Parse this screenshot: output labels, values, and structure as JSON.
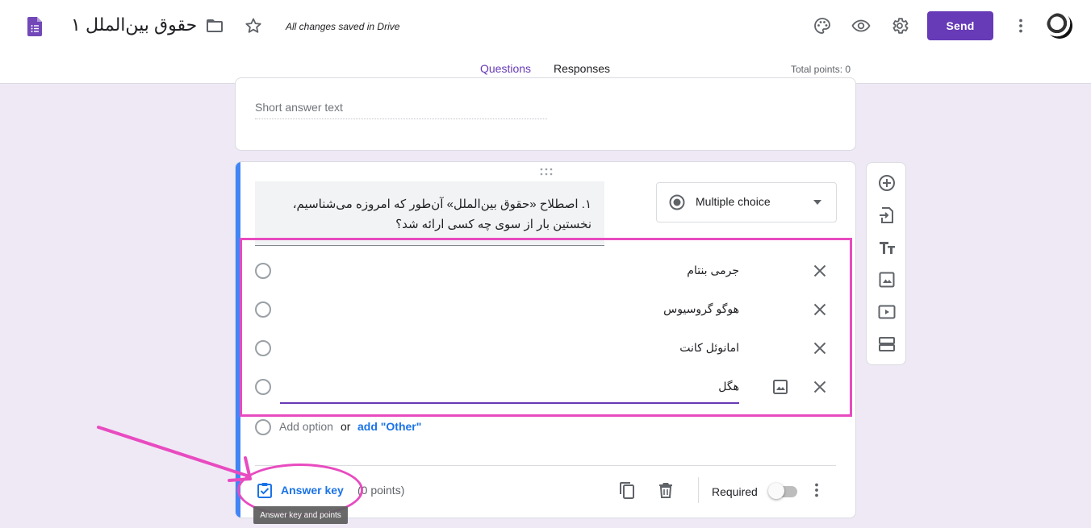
{
  "header": {
    "doc_title": "حقوق بین‌الملل ۱",
    "saved_status": "All changes saved in Drive",
    "send_label": "Send",
    "accent_color": "#673ab7"
  },
  "tabs": {
    "questions": "Questions",
    "responses": "Responses",
    "total_points": "Total points: 0"
  },
  "prev_question": {
    "short_answer_placeholder": "Short answer text"
  },
  "question": {
    "title": "۱. اصطلاح «حقوق بین‌الملل» آن‌طور که امروزه می‌شناسیم، نخستین بار از سوی چه کسی ارائه شد؟",
    "type": "Multiple choice",
    "options": [
      {
        "label": "جرمی بنتام"
      },
      {
        "label": "هوگو گروسیوس"
      },
      {
        "label": "امانوئل کانت"
      },
      {
        "label": "هگل"
      }
    ],
    "add_option": "Add option",
    "or": "or",
    "add_other": "add \"Other\"",
    "answer_key": "Answer key",
    "points": "(0 points)",
    "required_label": "Required",
    "required": false,
    "tooltip": "Answer key and points"
  },
  "toolbar": {
    "icons": [
      "add-question-icon",
      "import-questions-icon",
      "add-title-icon",
      "add-image-icon",
      "add-video-icon",
      "add-section-icon"
    ]
  },
  "annotation_color": "#e84bc0"
}
